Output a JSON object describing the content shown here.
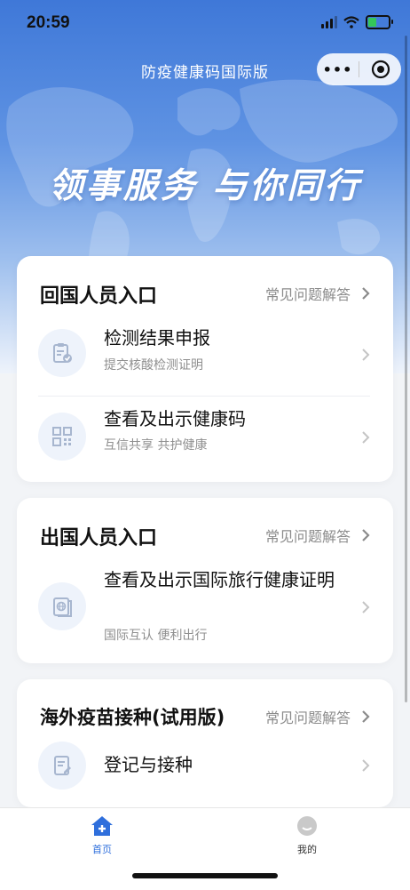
{
  "status_bar": {
    "time": "20:59"
  },
  "nav": {
    "title": "防疫健康码国际版",
    "more_icon": "more-dots-icon",
    "close_icon": "target-close-icon"
  },
  "hero": {
    "slogan": "领事服务 与你同行"
  },
  "sections": [
    {
      "title": "回国人员入口",
      "faq_label": "常见问题解答",
      "items": [
        {
          "label": "检测结果申报",
          "sub": "提交核酸检测证明",
          "icon": "clipboard-check-icon"
        },
        {
          "label": "查看及出示健康码",
          "sub": "互信共享 共护健康",
          "icon": "qr-code-icon"
        }
      ]
    },
    {
      "title": "出国人员入口",
      "faq_label": "常见问题解答",
      "items": [
        {
          "label": "查看及出示国际旅行健康证明",
          "sub": "国际互认 便利出行",
          "icon": "passport-globe-icon"
        }
      ]
    },
    {
      "title": "海外疫苗接种(试用版)",
      "faq_label": "常见问题解答",
      "items": [
        {
          "label": "登记与接种",
          "sub": "",
          "icon": "register-form-icon"
        }
      ]
    }
  ],
  "tabbar": {
    "tabs": [
      {
        "label": "首页",
        "icon": "home-icon",
        "active": true
      },
      {
        "label": "我的",
        "icon": "profile-face-icon",
        "active": false
      }
    ]
  },
  "colors": {
    "accent": "#2f6fdc",
    "hero_top": "#3f78d8",
    "background": "#f2f4f7",
    "muted_text": "#8b8b8b"
  }
}
